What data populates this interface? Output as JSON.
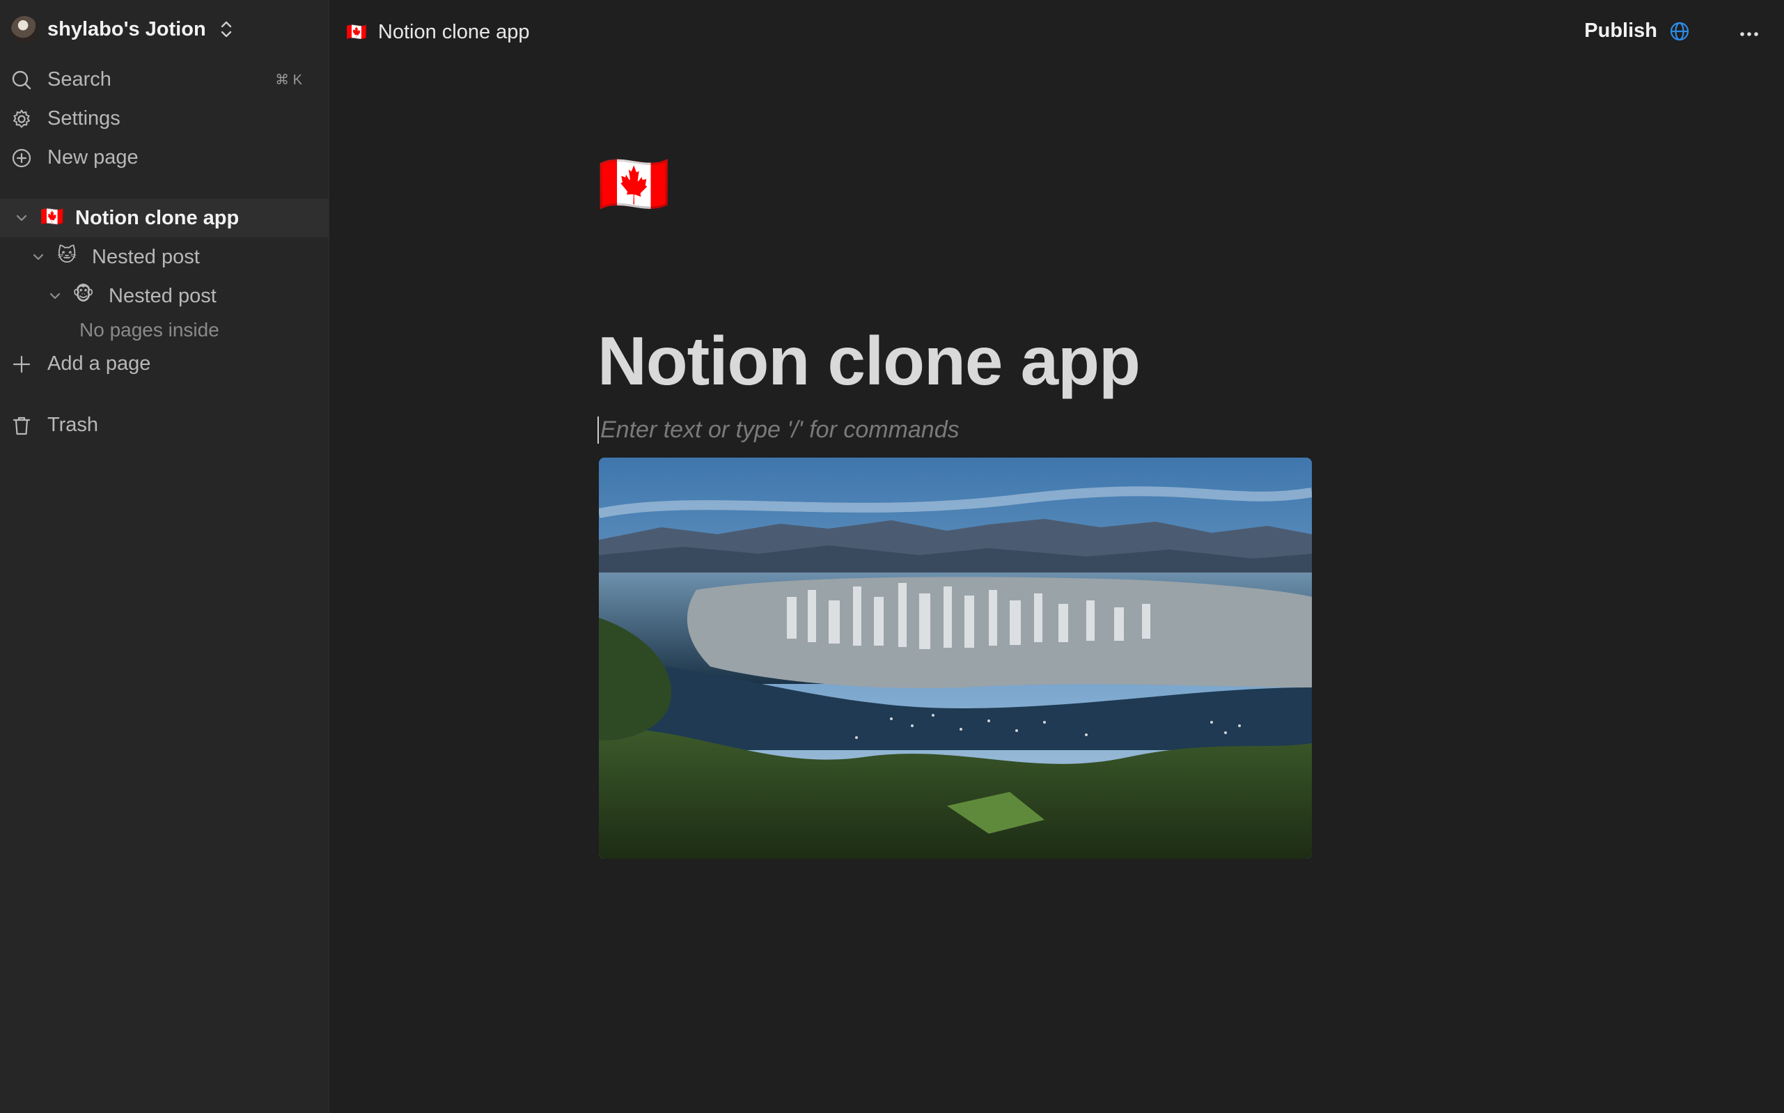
{
  "workspace": {
    "name": "shylabo's Jotion"
  },
  "sidebar": {
    "search_label": "Search",
    "search_shortcut": "⌘ K",
    "settings_label": "Settings",
    "new_page_label": "New page",
    "pages": [
      {
        "emoji": "🇨🇦",
        "title": "Notion clone app"
      },
      {
        "emoji": "🐱",
        "title": "Nested post"
      },
      {
        "emoji": "🐵",
        "title": "Nested post"
      }
    ],
    "empty_label": "No pages inside",
    "add_page_label": "Add a page",
    "trash_label": "Trash"
  },
  "topbar": {
    "breadcrumb_emoji": "🇨🇦",
    "breadcrumb_title": "Notion clone app",
    "publish_label": "Publish"
  },
  "document": {
    "icon": "🇨🇦",
    "title": "Notion clone app",
    "placeholder": "Enter text or type '/' for commands"
  },
  "colors": {
    "accent": "#2e8be6",
    "background": "#1f1f1f",
    "sidebar": "#262626"
  }
}
